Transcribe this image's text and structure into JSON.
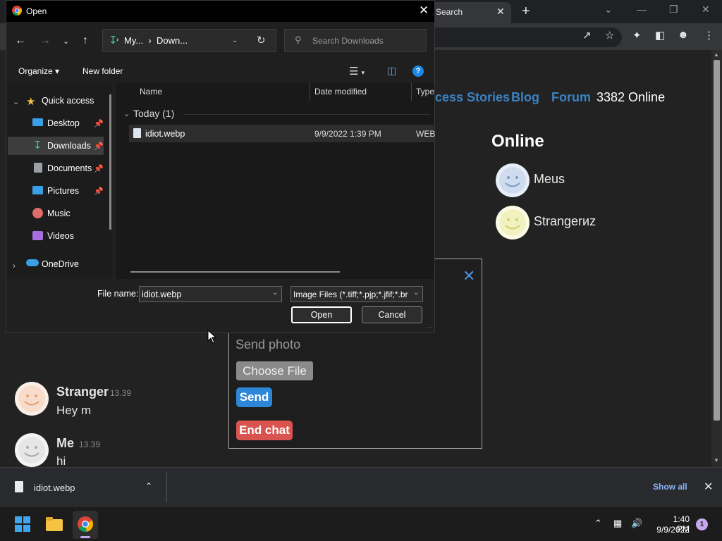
{
  "browser": {
    "tab_title": "Search",
    "tab_close": "✕",
    "new_tab": "+"
  },
  "website": {
    "nav": [
      "cess Stories",
      "Blog",
      "Forum"
    ],
    "online_count": "3382 Online",
    "online_heading": "Online",
    "online_users": [
      "Meus",
      "Strangerиz"
    ]
  },
  "chat": {
    "messages": [
      {
        "name": "Stranger",
        "time": "13.39",
        "text": "Hey m"
      },
      {
        "name": "Me",
        "time": "13.39",
        "text": "hi"
      }
    ]
  },
  "photo_panel": {
    "close": "✕",
    "send_photo": "Send photo",
    "choose_file": "Choose File",
    "send": "Send",
    "end_chat": "End chat"
  },
  "download_bar": {
    "file": "idiot.webp",
    "show_all": "Show all"
  },
  "taskbar": {
    "time": "1:40 PM",
    "date": "9/9/2022",
    "notifications": "1"
  },
  "dialog": {
    "title": "Open",
    "address": {
      "part1": "My...",
      "part2": "Down..."
    },
    "search_placeholder": "Search Downloads",
    "organize": "Organize",
    "new_folder": "New folder",
    "nav_items": {
      "quick_access": "Quick access",
      "desktop": "Desktop",
      "downloads": "Downloads",
      "documents": "Documents",
      "pictures": "Pictures",
      "music": "Music",
      "videos": "Videos",
      "onedrive": "OneDrive"
    },
    "columns": {
      "name": "Name",
      "date_modified": "Date modified",
      "type": "Type"
    },
    "group": "Today (1)",
    "file": {
      "name": "idiot.webp",
      "date": "9/9/2022 1:39 PM",
      "type": "WEBP"
    },
    "file_name_label": "File name:",
    "file_name_value": "idiot.webp",
    "file_type_value": "Image Files (*.tiff;*.pjp;*.jfif;*.br",
    "open_button": "Open",
    "cancel_button": "Cancel"
  },
  "colors": {
    "link": "#3b82c4",
    "send": "#2d86d8",
    "end_chat": "#d9534f",
    "accent_download": "#4cc2a5"
  }
}
